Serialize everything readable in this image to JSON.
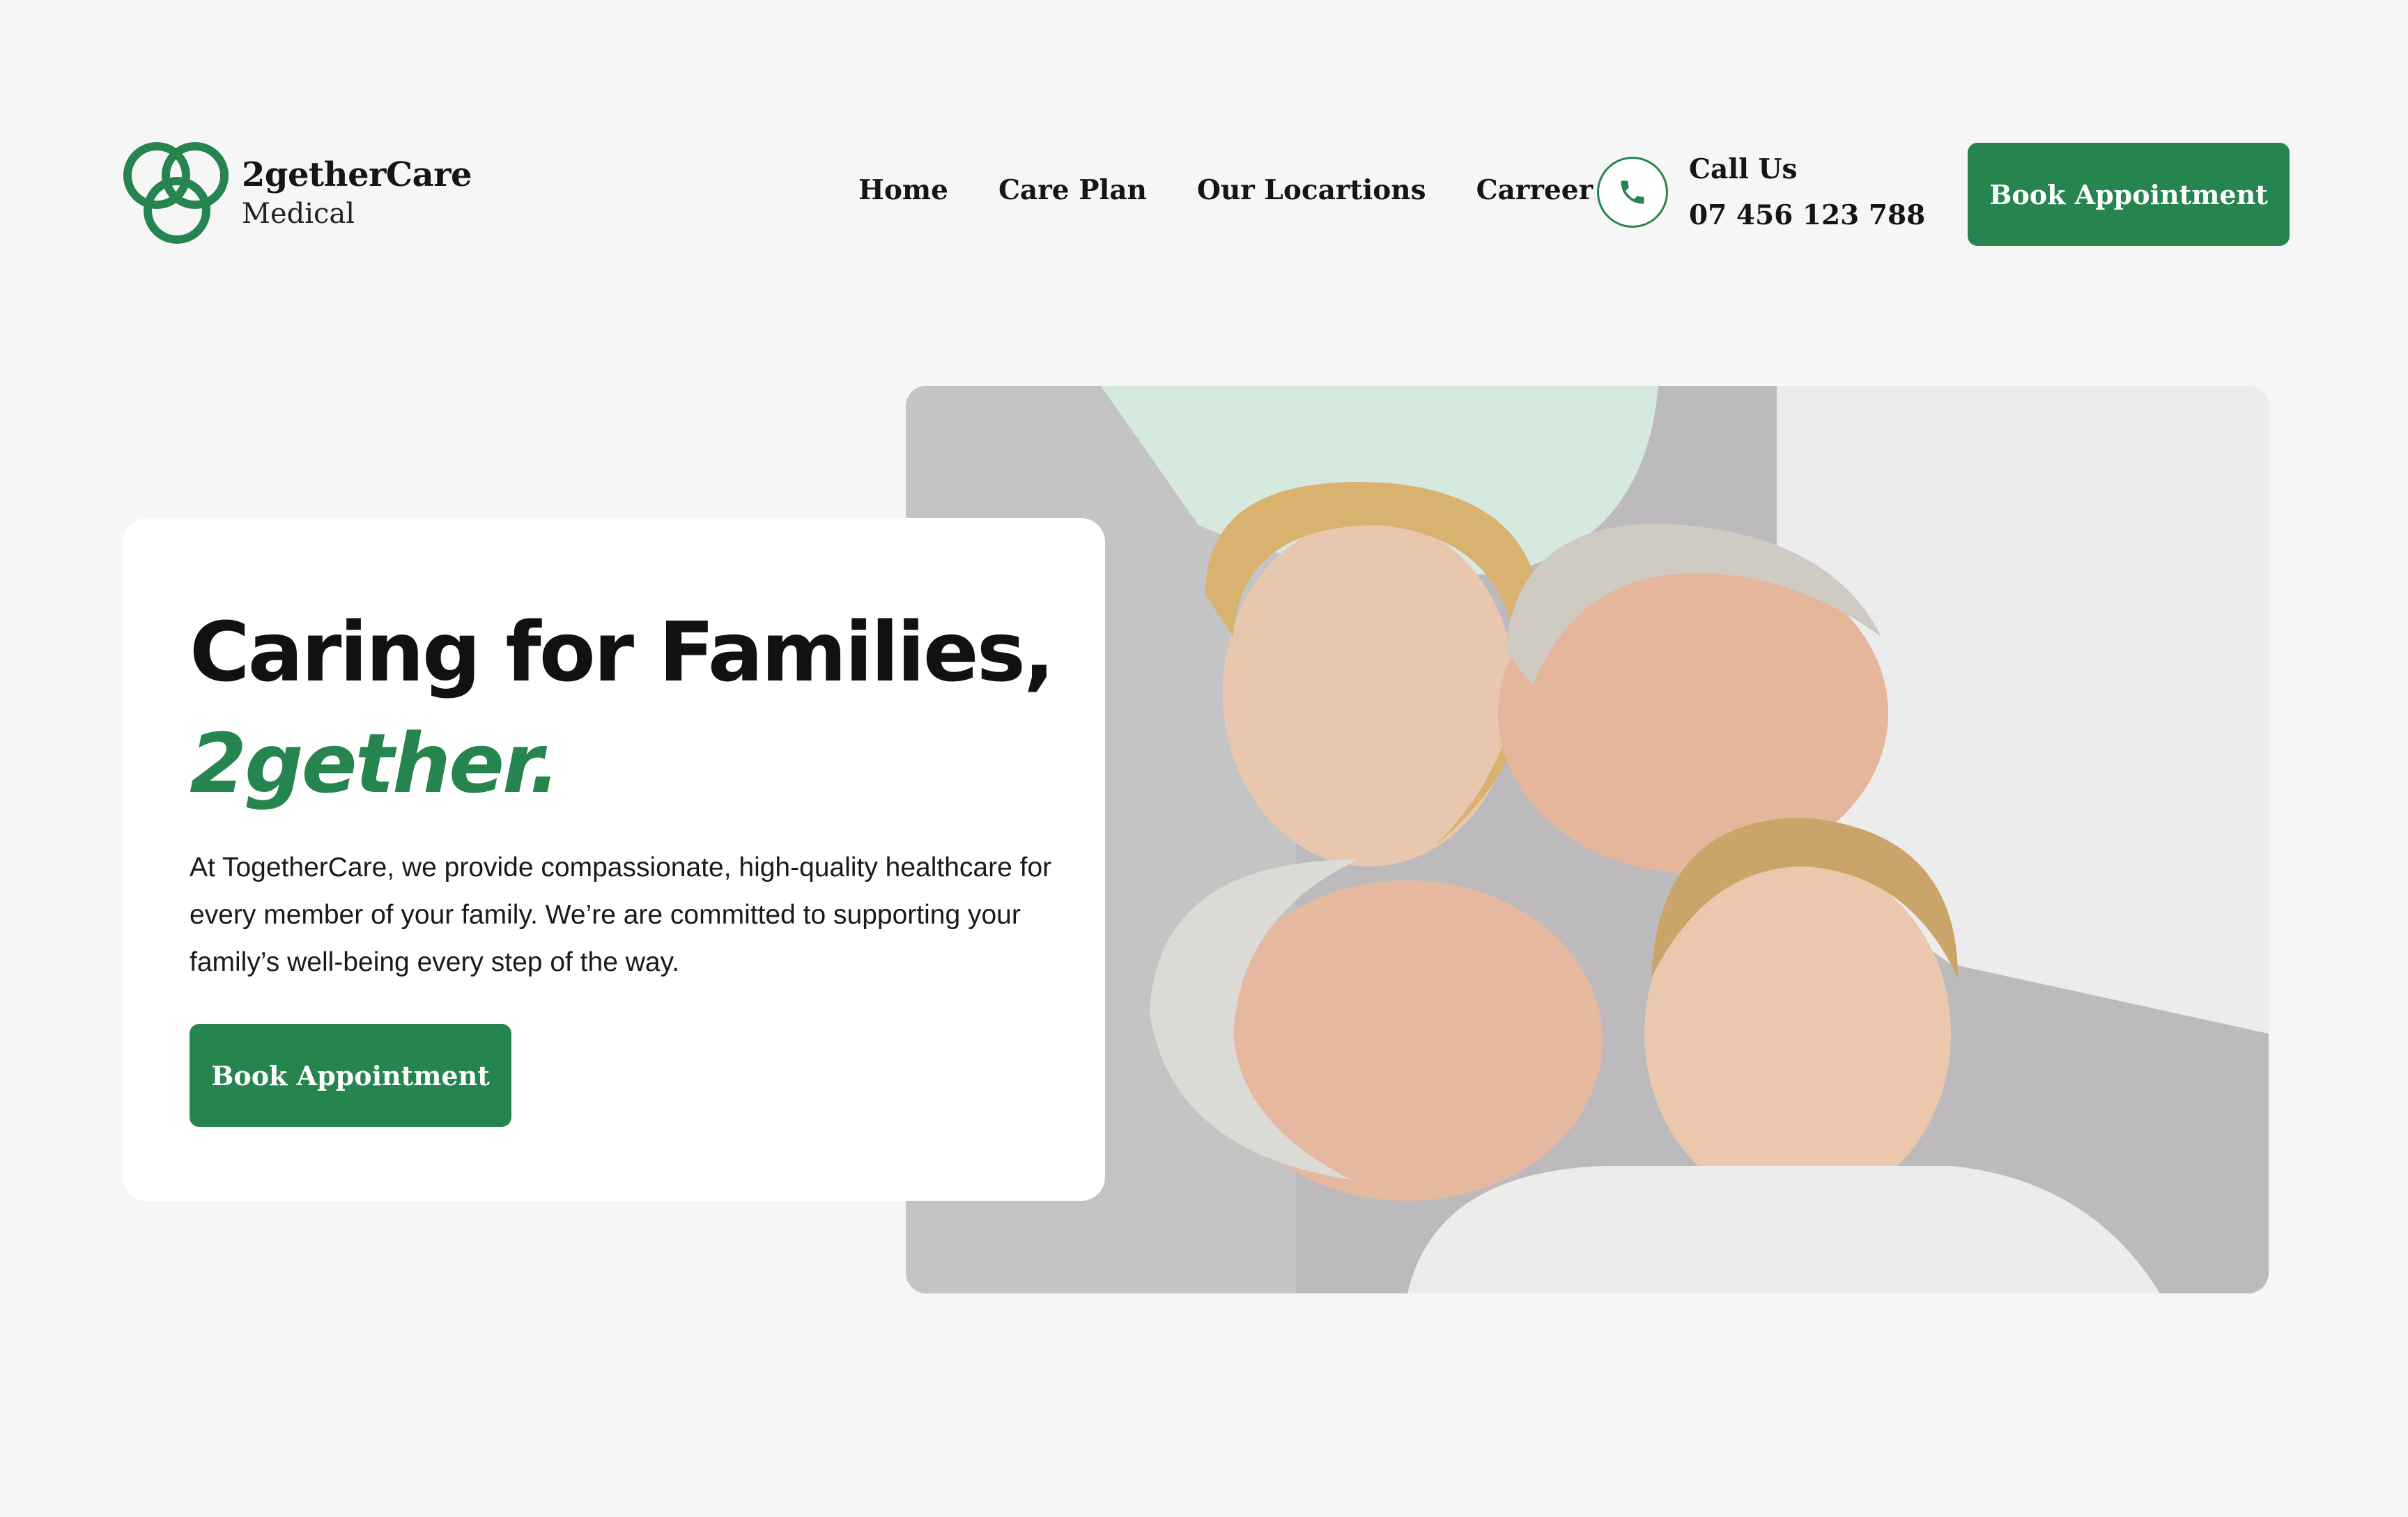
{
  "brand": {
    "name": "2getherCare",
    "subtitle": "Medical"
  },
  "nav": {
    "items": [
      {
        "label": "Home"
      },
      {
        "label": "Care Plan"
      },
      {
        "label": "Our Locartions"
      },
      {
        "label": "Carreer"
      }
    ]
  },
  "contact": {
    "label": "Call Us",
    "phone": "07 456 123 788"
  },
  "header": {
    "cta_label": "Book Appointment"
  },
  "hero": {
    "title_line1": "Caring for Families,",
    "title_line2": "2gether.",
    "description": "At TogetherCare, we provide compassionate, high-quality healthcare for every member of your family. We’re  are committed to supporting your family’s well-being every step of the way.",
    "cta_label": "Book Appointment"
  },
  "colors": {
    "accent": "#26844e",
    "background": "#f6f6f6",
    "card": "#ffffff"
  },
  "icons": {
    "logo": "interlocking-circles-icon",
    "phone": "phone-icon"
  }
}
